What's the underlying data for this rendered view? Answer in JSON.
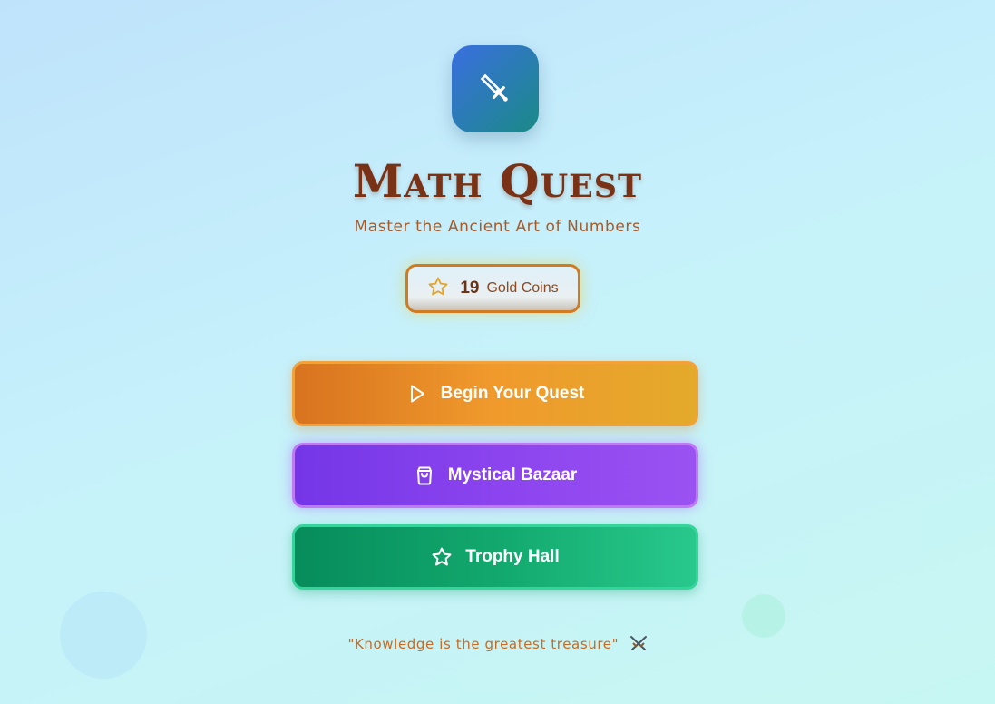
{
  "app": {
    "icon": "sword-icon",
    "title": "Math Quest",
    "subtitle": "Master the Ancient Art of Numbers"
  },
  "coins": {
    "icon": "star-icon",
    "count": "19",
    "label": "Gold Coins"
  },
  "menu": {
    "begin_label": "Begin Your Quest",
    "begin_icon": "play-icon",
    "bazaar_label": "Mystical Bazaar",
    "bazaar_icon": "shopping-bag-icon",
    "trophy_label": "Trophy Hall",
    "trophy_icon": "star-icon"
  },
  "footer": {
    "quote": "\"Knowledge is the greatest treasure\"",
    "quote_icon": "crossed-swords-icon"
  },
  "colors": {
    "title": "#7a3216",
    "begin_button": "#f09a2c",
    "bazaar_button": "#8b44ee",
    "trophy_button": "#12a86d"
  }
}
